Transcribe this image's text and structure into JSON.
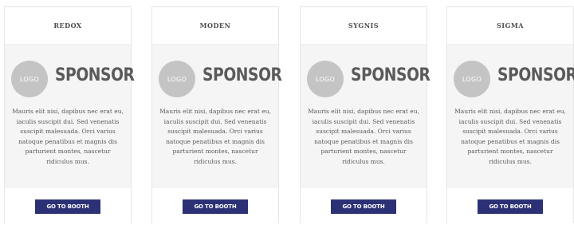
{
  "logo_text": "LOGO",
  "sponsor_text": "SPONSOR",
  "description": "Mauris elit nisi, dapibus nec erat eu, iaculis suscipit dui. Sed venenatis suscipit malesuada. Orci varius natoque penatibus et magnis dis parturient montes, nascetur ridiculus mus.",
  "button_label": "GO TO BOOTH",
  "accent_color": "#2c3175",
  "cards": [
    {
      "name": "REDOX"
    },
    {
      "name": "MODEN"
    },
    {
      "name": "SYGNIS"
    },
    {
      "name": "SIGMA"
    }
  ]
}
